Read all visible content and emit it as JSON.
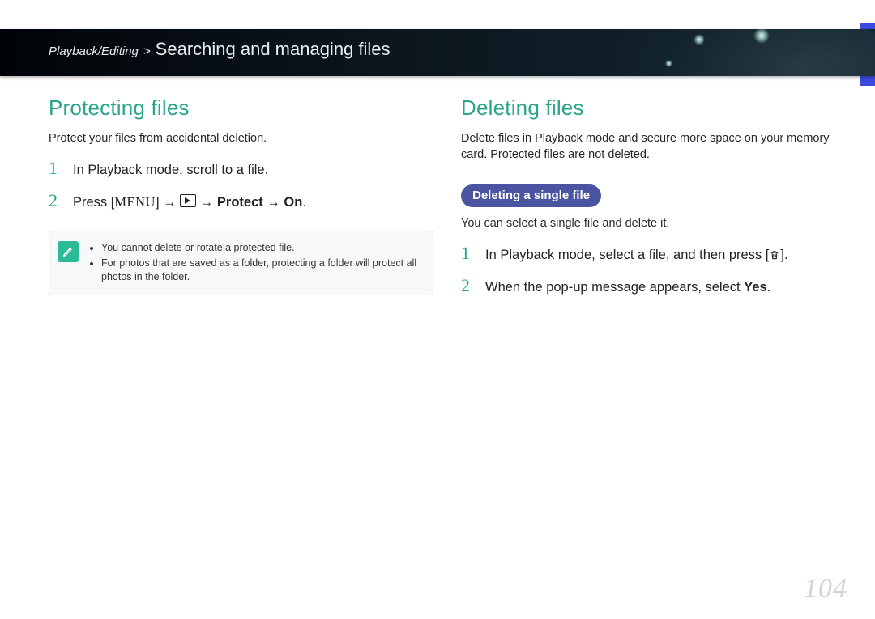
{
  "header": {
    "chapter": "Playback/Editing",
    "separator": " > ",
    "title": "Searching and managing files"
  },
  "left": {
    "heading": "Protecting files",
    "intro": "Protect your files from accidental deletion.",
    "steps": [
      {
        "num": "1",
        "text": "In Playback mode, scroll to a file."
      },
      {
        "num": "2",
        "press": "Press [",
        "menu": "MENU",
        "close_arrow": "] → ",
        "arrow2": " → ",
        "protect": "Protect",
        "arrow3": " → ",
        "on": "On",
        "period": "."
      }
    ],
    "notes": [
      "You cannot delete or rotate a protected file.",
      "For photos that are saved as a folder, protecting a folder will protect all photos in the folder."
    ]
  },
  "right": {
    "heading": "Deleting files",
    "intro": "Delete files in Playback mode and secure more space on your memory card. Protected files are not deleted.",
    "pill": "Deleting a single file",
    "subintro": "You can select a single file and delete it.",
    "steps": [
      {
        "num": "1",
        "pre": "In Playback mode, select a file, and then press [",
        "post": "]."
      },
      {
        "num": "2",
        "pre": "When the pop-up message appears, select ",
        "yes": "Yes",
        "post": "."
      }
    ]
  },
  "page_number": "104"
}
